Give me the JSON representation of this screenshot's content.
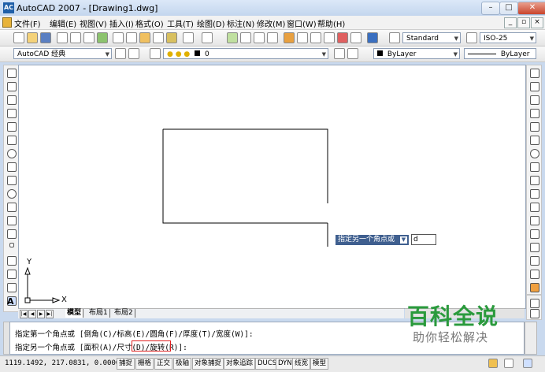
{
  "window": {
    "title": "AutoCAD 2007 - [Drawing1.dwg]",
    "app_icon_text": "AC",
    "minimize": "–",
    "maximize": "□",
    "close": "✕"
  },
  "menubar": {
    "items": [
      "文件(F)",
      "编辑(E)",
      "视图(V)",
      "插入(I)",
      "格式(O)",
      "工具(T)",
      "绘图(D)",
      "标注(N)",
      "修改(M)",
      "窗口(W)",
      "帮助(H)"
    ],
    "mdi_min": "_",
    "mdi_restore": "▫",
    "mdi_close": "×"
  },
  "toolbar1": {
    "text_style": "Standard",
    "dim_style": "ISO-25"
  },
  "toolbar2": {
    "workspace": "AutoCAD 经典",
    "layer": "0",
    "color": "ByLayer",
    "linetype": "ByLayer"
  },
  "tabs": {
    "items": [
      "模型",
      "布局1",
      "布局2"
    ],
    "nav": [
      "|◀",
      "◀",
      "▶",
      "▶|"
    ]
  },
  "ucs": {
    "x_label": "X",
    "y_label": "Y"
  },
  "dynamic_input": {
    "prompt": "指定另一个角点或",
    "arrow": "▼",
    "value": "d"
  },
  "command": {
    "line1": "指定第一个角点或 [倒角(C)/标高(E)/圆角(F)/厚度(T)/宽度(W)]:",
    "line2_pre": "指定另一个角点或 [面积(A)/",
    "line2_highlight": "尺寸(D)",
    "line2_post": "/旋转(R)]:"
  },
  "status": {
    "coords": "1119.1492, 217.0831, 0.0000",
    "buttons": [
      "捕捉",
      "栅格",
      "正交",
      "极轴",
      "对象捕捉",
      "对象追踪",
      "DUCS",
      "DYN",
      "线宽",
      "模型"
    ]
  },
  "watermark": {
    "title": "百科全说",
    "subtitle": "助你轻松解决"
  }
}
